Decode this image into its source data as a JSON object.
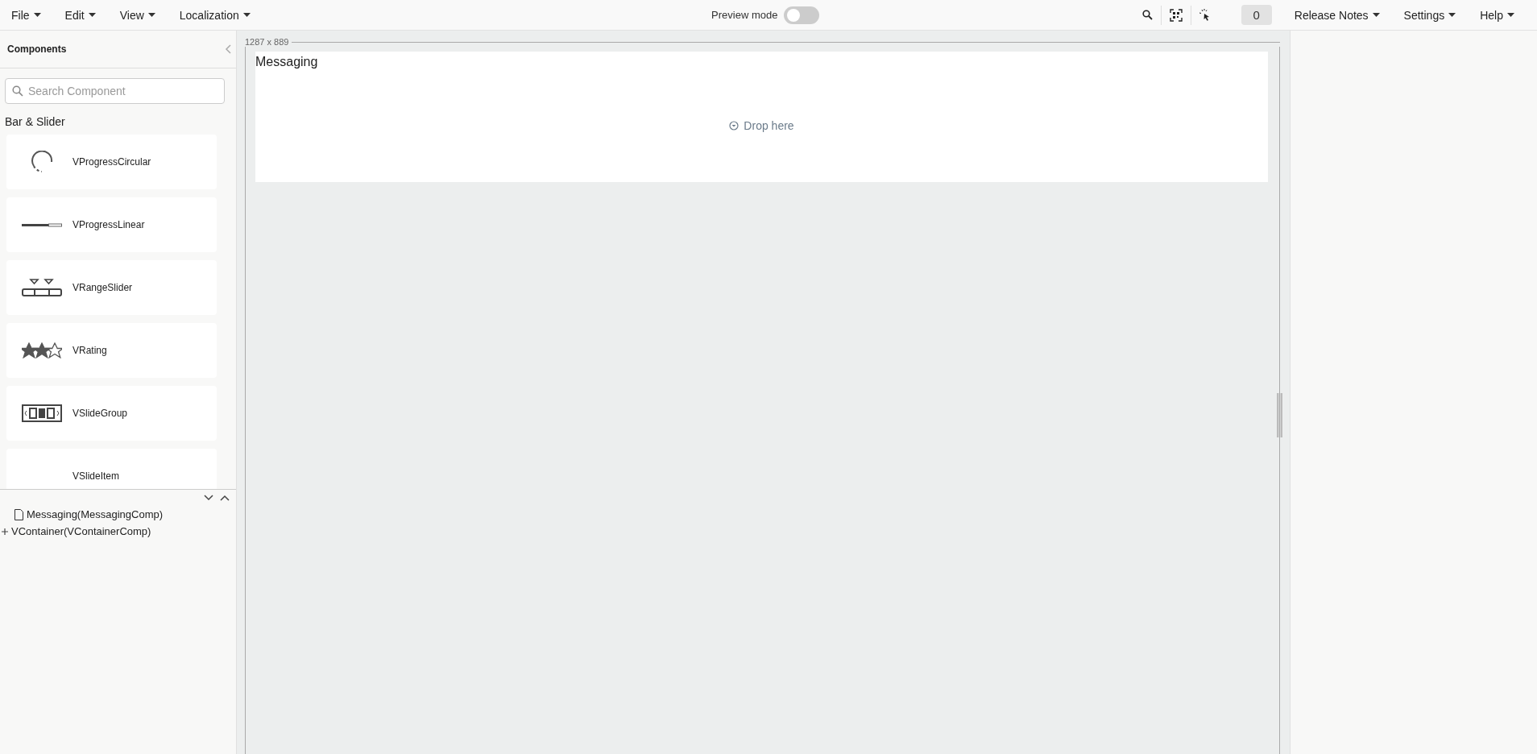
{
  "menu": [
    {
      "label": "File"
    },
    {
      "label": "Edit"
    },
    {
      "label": "View"
    },
    {
      "label": "Localization"
    }
  ],
  "preview": {
    "label": "Preview mode",
    "on": false
  },
  "counter": "0",
  "right_menu": [
    {
      "label": "Release Notes"
    },
    {
      "label": "Settings"
    },
    {
      "label": "Help"
    }
  ],
  "components_panel": {
    "title": "Components",
    "search": {
      "placeholder": "Search Component"
    },
    "group": "Bar & Slider",
    "items": [
      {
        "kind": "circular",
        "label": "VProgressCircular"
      },
      {
        "kind": "linear",
        "label": "VProgressLinear"
      },
      {
        "kind": "range",
        "label": "VRangeSlider"
      },
      {
        "kind": "rating",
        "label": "VRating"
      },
      {
        "kind": "slidegroup",
        "label": "VSlideGroup"
      },
      {
        "kind": "none",
        "label": "VSlideItem"
      }
    ]
  },
  "tree": [
    {
      "kind": "file",
      "label": "Messaging(MessagingComp)"
    },
    {
      "kind": "plus",
      "label": "VContainer(VContainerComp)"
    }
  ],
  "canvas": {
    "size": "1287 x 889",
    "title": "Messaging",
    "drop": "Drop here"
  }
}
